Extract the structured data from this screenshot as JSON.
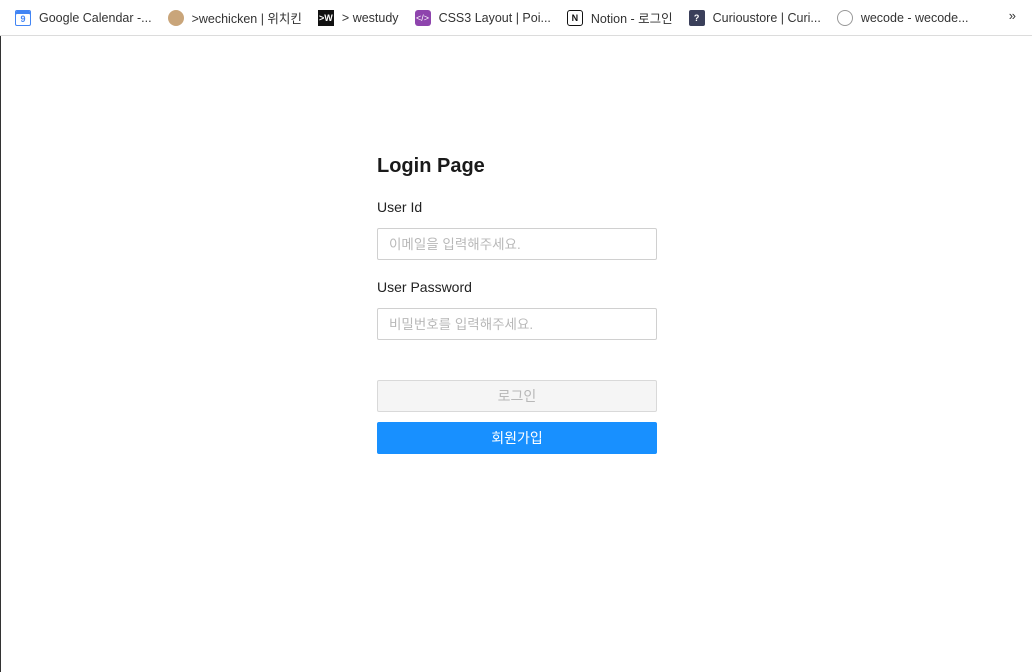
{
  "bookmarks": [
    {
      "label": "Google Calendar -...",
      "icon": "google-calendar-icon",
      "glyph": "9"
    },
    {
      "label": ">wechicken | 위치킨",
      "icon": "wechicken-icon",
      "glyph": ""
    },
    {
      "label": "> westudy",
      "icon": "westudy-icon",
      "glyph": ">W"
    },
    {
      "label": "CSS3 Layout | Poi...",
      "icon": "code-icon",
      "glyph": "</>"
    },
    {
      "label": "Notion - 로그인",
      "icon": "notion-icon",
      "glyph": "N"
    },
    {
      "label": "Curioustore | Curi...",
      "icon": "question-icon",
      "glyph": "?"
    },
    {
      "label": "wecode - wecode...",
      "icon": "wecode-icon",
      "glyph": ""
    }
  ],
  "bookmarks_overflow": "»",
  "login": {
    "title": "Login Page",
    "user_id_label": "User Id",
    "user_id_placeholder": "이메일을 입력해주세요.",
    "password_label": "User Password",
    "password_placeholder": "비밀번호를 입력해주세요.",
    "login_button": "로그인",
    "signup_button": "회원가입"
  },
  "colors": {
    "primary": "#1890ff",
    "disabled_bg": "#f5f5f5",
    "disabled_text": "#b8b8b8"
  }
}
